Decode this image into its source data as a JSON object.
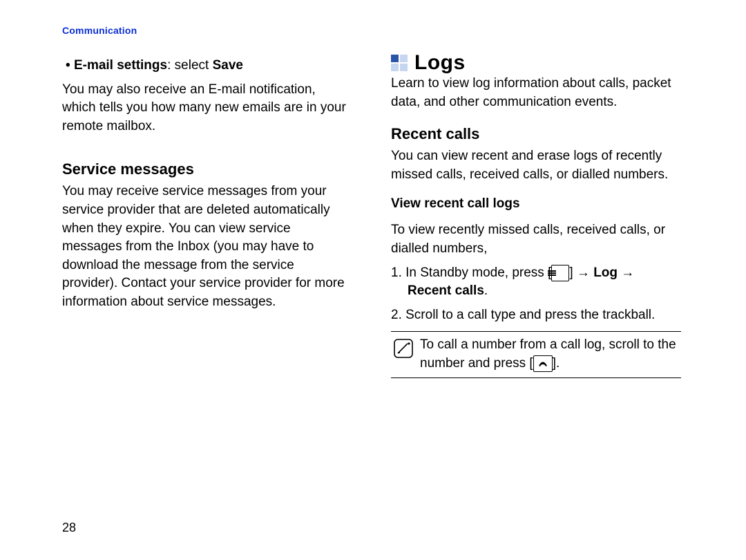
{
  "header": {
    "section_link": "Communication"
  },
  "left": {
    "bullet": {
      "label_bold_1": "E-mail settings",
      "label_mid": ": select ",
      "label_bold_2": "Save"
    },
    "email_notification": "You may also receive an E-mail notification, which tells you how many new emails are in your remote mailbox.",
    "service_heading": "Service messages",
    "service_body": "You may receive service messages from your service provider that are deleted automatically when they expire. You can view service messages from the Inbox (you may have to download the message from the service provider). Contact your service provider for more information about service messages."
  },
  "right": {
    "logs_title": "Logs",
    "logs_intro": "Learn to view log information about calls, packet data, and other communication events.",
    "recent_heading": "Recent calls",
    "recent_body": "You can view recent and erase logs of recently missed calls, received calls, or dialled numbers.",
    "view_heading": "View recent call logs",
    "view_body": "To view recently missed calls, received calls, or dialled numbers,",
    "step1_pre": "1. In Standby mode, press [",
    "step1_mid1": "] → ",
    "step1_log": "Log",
    "step1_mid2": " → ",
    "step1_recent": "Recent calls",
    "step1_end": ".",
    "step2": "2. Scroll to a call type and press the trackball.",
    "note_pre": "To call a number from a call log, scroll to the number and press [",
    "note_post": "].",
    "menu_icon_name": "menu-key-icon",
    "call_icon_name": "call-key-icon"
  },
  "page_number": "28"
}
